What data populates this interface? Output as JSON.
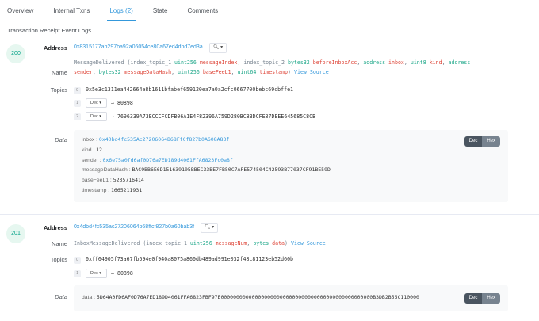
{
  "tabs": [
    "Overview",
    "Internal Txns",
    "Logs (2)",
    "State",
    "Comments"
  ],
  "active_tab": "Logs (2)",
  "section_title": "Transaction Receipt Event Logs",
  "labels": {
    "address": "Address",
    "name": "Name",
    "topics": "Topics",
    "data": "Data",
    "view_source": "View Source",
    "dec": "Dec",
    "hex": "Hex",
    "arrow": "→"
  },
  "logs": [
    {
      "index": "200",
      "address": "0x8315177ab297ba92a06054ce80a67ed4dbd7ed3a",
      "name_parts": [
        {
          "t": "MessageDelivered (index_topic_1 ",
          "c": "n"
        },
        {
          "t": "uint256 ",
          "c": "g"
        },
        {
          "t": "messageIndex",
          "c": "r"
        },
        {
          "t": ", index_topic_2 ",
          "c": "n"
        },
        {
          "t": "bytes32 ",
          "c": "g"
        },
        {
          "t": "beforeInboxAcc",
          "c": "r"
        },
        {
          "t": ", ",
          "c": "n"
        },
        {
          "t": "address ",
          "c": "g"
        },
        {
          "t": "inbox",
          "c": "r"
        },
        {
          "t": ", ",
          "c": "n"
        },
        {
          "t": "uint8 ",
          "c": "g"
        },
        {
          "t": "kind",
          "c": "r"
        },
        {
          "t": ", ",
          "c": "n"
        },
        {
          "t": "address",
          "c": "g"
        }
      ],
      "name_parts2": [
        {
          "t": "sender",
          "c": "r"
        },
        {
          "t": ", ",
          "c": "n"
        },
        {
          "t": "bytes32 ",
          "c": "g"
        },
        {
          "t": "messageDataHash",
          "c": "r"
        },
        {
          "t": ", ",
          "c": "n"
        },
        {
          "t": "uint256 ",
          "c": "g"
        },
        {
          "t": "baseFeeL1",
          "c": "r"
        },
        {
          "t": ", ",
          "c": "n"
        },
        {
          "t": "uint64 ",
          "c": "g"
        },
        {
          "t": "timestamp",
          "c": "r"
        },
        {
          "t": ")",
          "c": "n"
        }
      ],
      "topic0": "0x5e3c1311ea442664e8b1611bfabef659120ea7a0a2cfc0667700bebc69cbffe1",
      "topic1": "80898",
      "topic2": "7696339A73ECCCFCDFB06A1E4F82396A759D280BC83DCFE87DEEE645685C8CB",
      "data": [
        {
          "k": "inbox",
          "v": "0x40bd4fc535Ac27206064B68FfCf827b0A608A83f",
          "link": true
        },
        {
          "k": "kind",
          "v": "12"
        },
        {
          "k": "sender",
          "v": "0x6e75a0fd6af0D76a7ED189d4061FfA6823Fc0a8f",
          "link": true
        },
        {
          "k": "messageDataHash",
          "v": "BAC9BB6E6D151639105BBEC33BE7FB50C7AFE574504C42593B77037CF91BE59D"
        },
        {
          "k": "baseFeeL1",
          "v": "5235716414"
        },
        {
          "k": "timestamp",
          "v": "1665211931"
        }
      ]
    },
    {
      "index": "201",
      "address": "0x4dbd4fc535ac27206064b68ffcf827b0a60bab3f",
      "name_parts": [
        {
          "t": "InboxMessageDelivered (index_topic_1 ",
          "c": "n"
        },
        {
          "t": "uint256 ",
          "c": "g"
        },
        {
          "t": "messageNum",
          "c": "r"
        },
        {
          "t": ", ",
          "c": "n"
        },
        {
          "t": "bytes ",
          "c": "g"
        },
        {
          "t": "data",
          "c": "r"
        },
        {
          "t": ")",
          "c": "n"
        }
      ],
      "topic0": "0xff64905f73a67fb594e0f940a8075a860db489ad991e032f48c81123eb52d60b",
      "topic1": "80898",
      "data": [
        {
          "k": "data",
          "v": "5D64A0FD6AF0D76A7ED189D4061FFA6823FBF97E0000000000000000000000000000000000000000000000000B3DB2B55C110000"
        }
      ]
    }
  ]
}
